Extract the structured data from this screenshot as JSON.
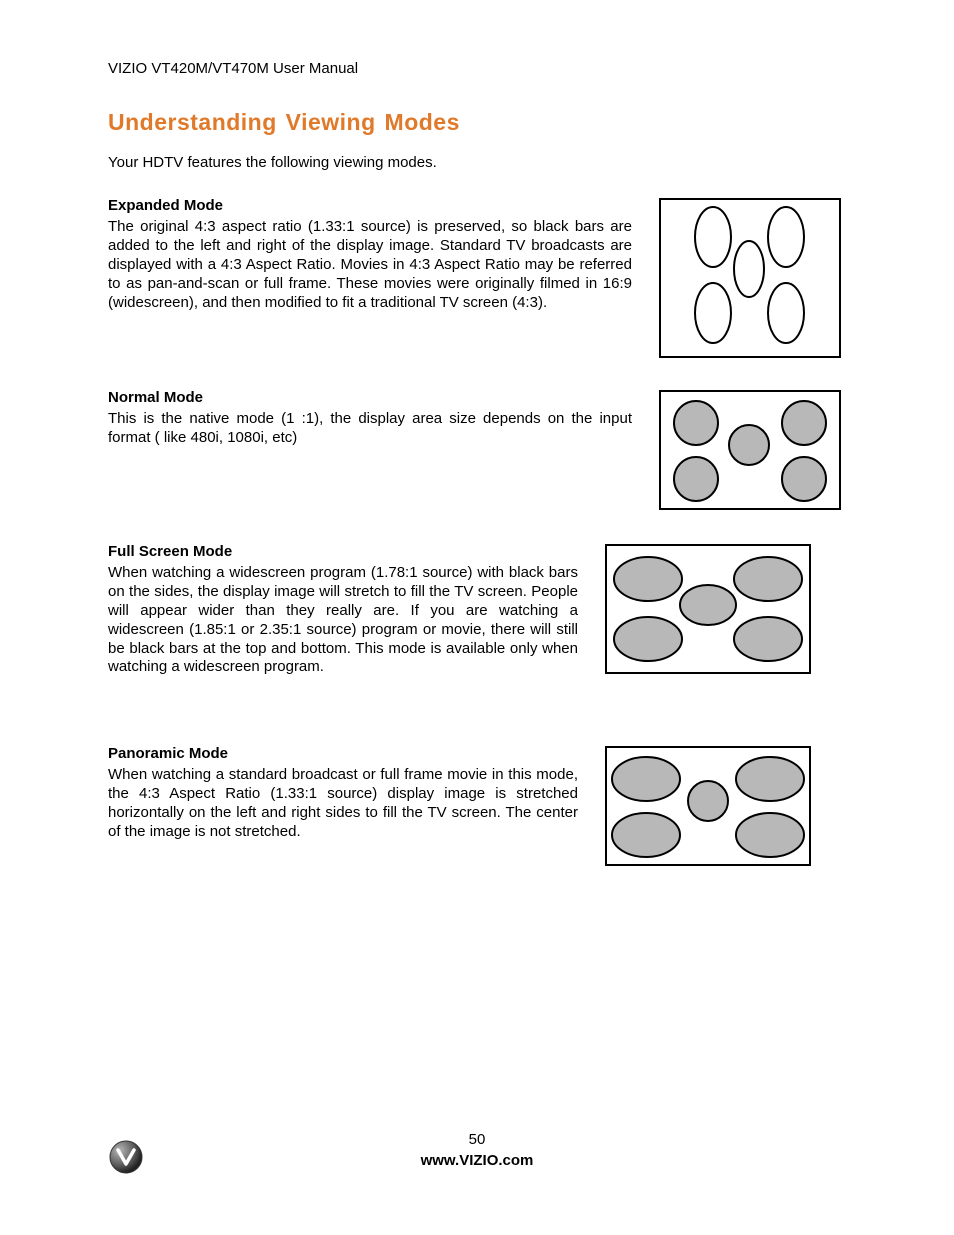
{
  "header": "VIZIO VT420M/VT470M User Manual",
  "title": "Understanding Viewing Modes",
  "intro": "Your HDTV features the following viewing modes.",
  "modes": {
    "expanded": {
      "heading": "Expanded Mode",
      "body": "The original 4:3 aspect ratio (1.33:1 source) is preserved, so black bars are added to the left and right of the display image.  Standard TV broadcasts are displayed with a 4:3 Aspect Ratio. Movies in 4:3 Aspect Ratio may be referred to as pan-and-scan or full frame. These movies were originally filmed in 16:9 (widescreen), and then modified to fit a traditional TV screen (4:3)."
    },
    "normal": {
      "heading": "Normal Mode",
      "body": "This is the native mode (1 :1), the display area size depends on the input format ( like 480i, 1080i, etc)"
    },
    "fullscreen": {
      "heading": "Full Screen Mode",
      "body": "When watching a widescreen program (1.78:1 source) with black bars on the sides, the display image will stretch to fill the TV screen. People will appear wider than they really are. If you are watching a widescreen (1.85:1 or 2.35:1 source) program or movie, there will still be black bars at the top and bottom. This mode is available only when watching a widescreen program."
    },
    "panoramic": {
      "heading": "Panoramic Mode",
      "body": "When watching a standard broadcast or full frame movie in this mode, the 4:3 Aspect Ratio (1.33:1 source) display image is stretched horizontally on the left and right sides to fill the TV screen. The center of the image is not stretched."
    }
  },
  "footer": {
    "page": "50",
    "site": "www.VIZIO.com"
  }
}
